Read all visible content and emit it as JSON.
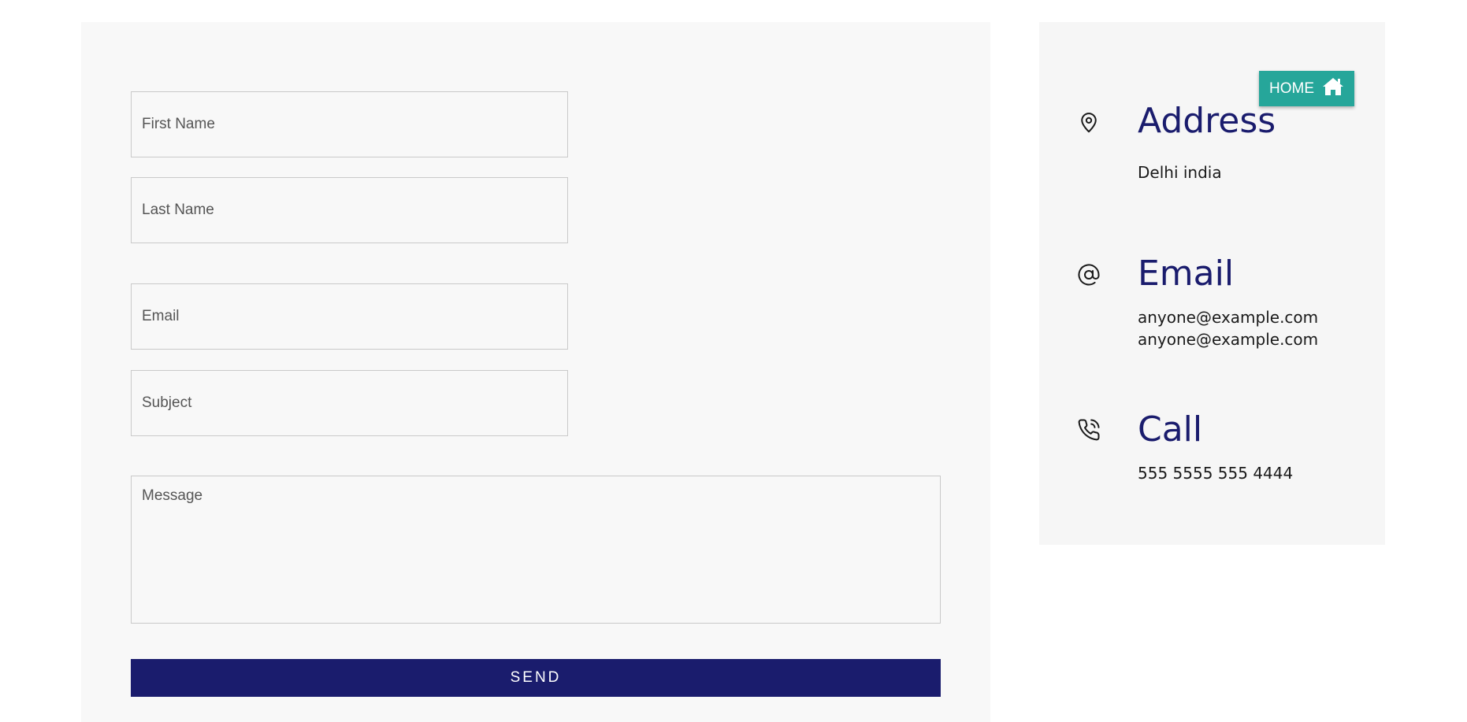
{
  "form": {
    "first_name_placeholder": "First Name",
    "last_name_placeholder": "Last Name",
    "email_placeholder": "Email",
    "subject_placeholder": "Subject",
    "message_placeholder": "Message",
    "send_label": "SEND"
  },
  "contact": {
    "address": {
      "title": "Address",
      "text": "Delhi india",
      "icon": "map-pin-icon"
    },
    "email": {
      "title": "Email",
      "lines": [
        "anyone@example.com",
        "anyone@example.com"
      ],
      "icon": "at-sign-icon"
    },
    "call": {
      "title": "Call",
      "text": "555 5555 555 4444",
      "icon": "phone-icon"
    }
  },
  "home_button": {
    "label": "HOME",
    "icon": "home-icon"
  },
  "colors": {
    "accent": "#1a1c6d",
    "home_button": "#26a69a",
    "panel_bg": "#f8f8f8"
  }
}
